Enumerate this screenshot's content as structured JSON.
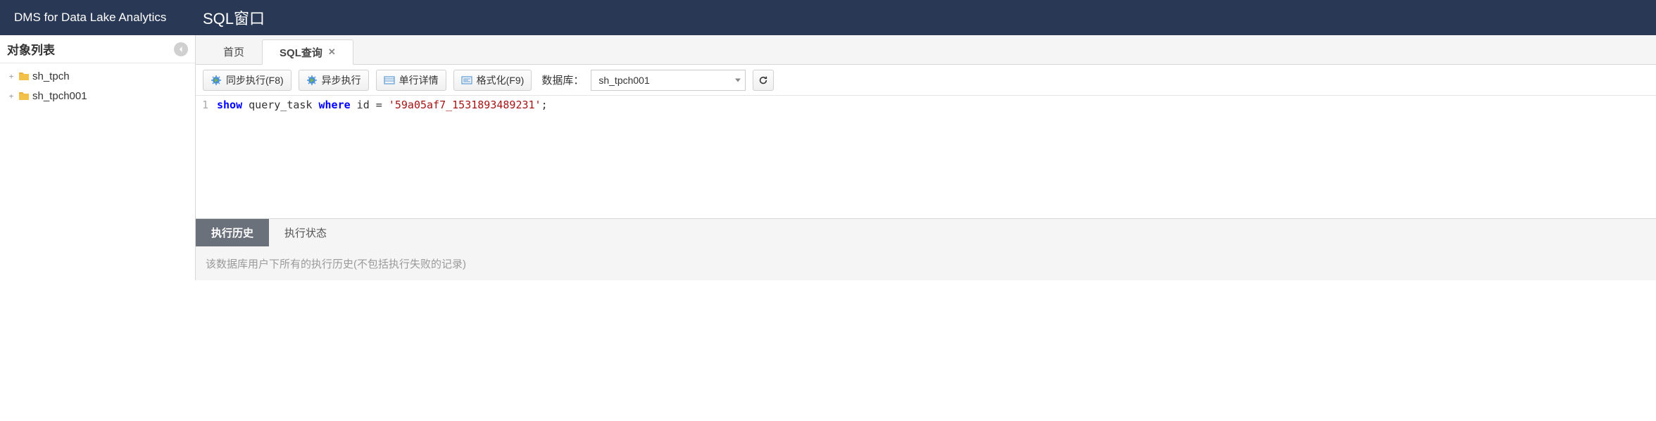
{
  "header": {
    "brand": "DMS for Data Lake Analytics",
    "title": "SQL窗口"
  },
  "sidebar": {
    "title": "对象列表",
    "items": [
      {
        "label": "sh_tpch"
      },
      {
        "label": "sh_tpch001"
      }
    ]
  },
  "tabs": [
    {
      "label": "首页",
      "active": false,
      "closable": false
    },
    {
      "label": "SQL查询",
      "active": true,
      "closable": true
    }
  ],
  "toolbar": {
    "sync_exec": "同步执行(F8)",
    "async_exec": "异步执行",
    "row_detail": "单行详情",
    "format": "格式化(F9)",
    "db_label": "数据库：",
    "db_selected": "sh_tpch001"
  },
  "editor": {
    "line_no": "1",
    "tokens": {
      "kw1": "show",
      "plain1": " query_task ",
      "kw2": "where",
      "plain2": " id = ",
      "str": "'59a05af7_1531893489231'",
      "plain3": ";"
    }
  },
  "bottom_tabs": {
    "history": "执行历史",
    "status": "执行状态"
  },
  "info_text": "该数据库用户下所有的执行历史(不包括执行失败的记录)"
}
